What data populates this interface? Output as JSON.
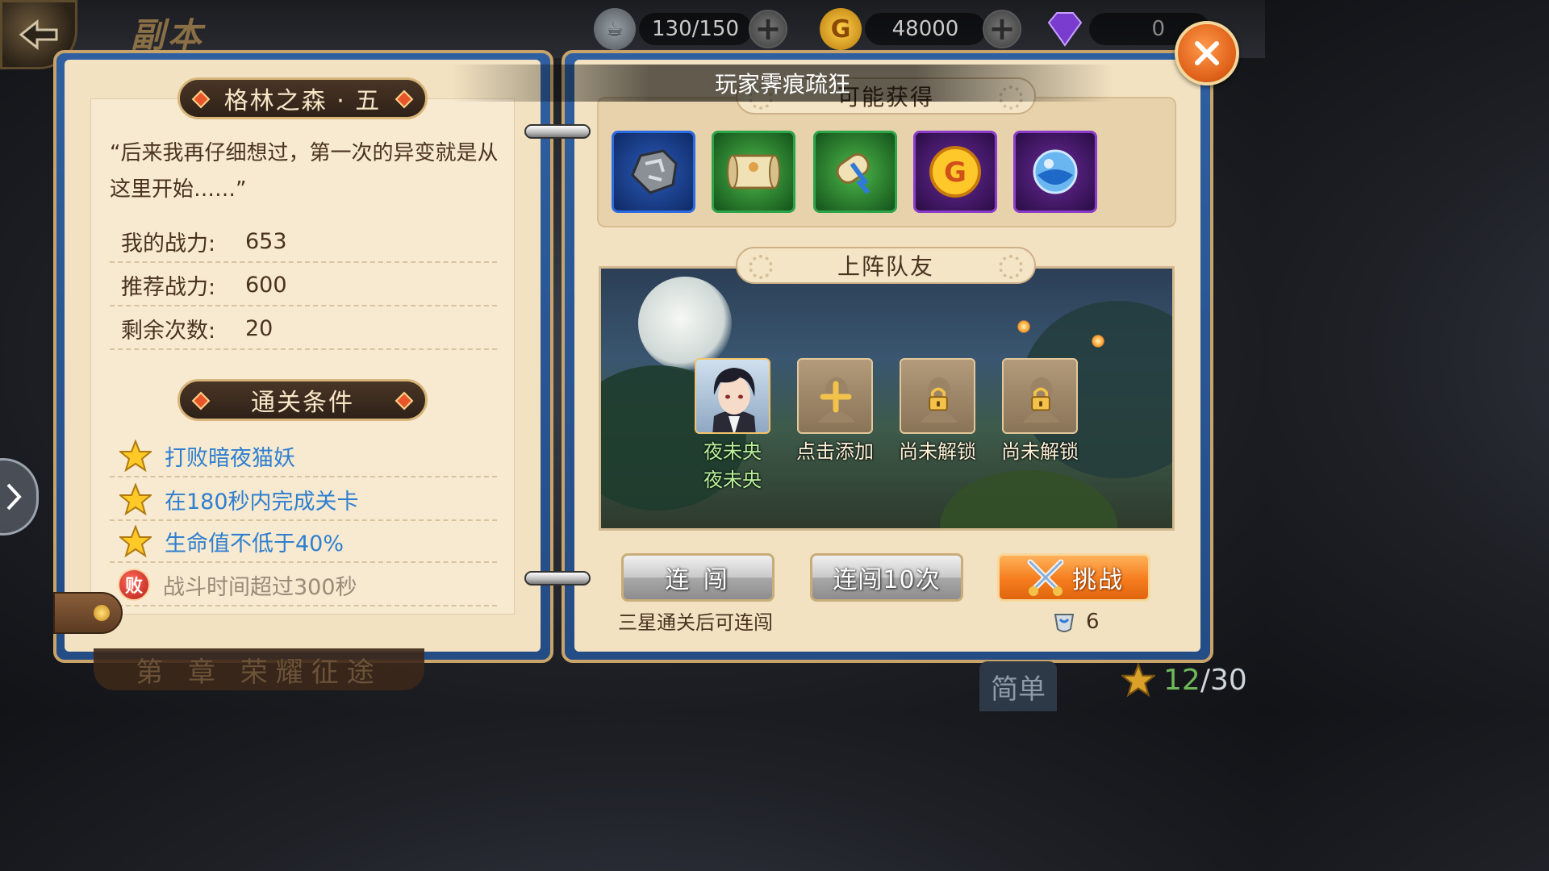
{
  "header": {
    "title": "副本",
    "stamina": "130/150",
    "gold": "48000",
    "gems": "0"
  },
  "notice": "玩家霁痕疏狂",
  "stage": {
    "name": "格林之森 · 五",
    "quote": "“后来我再仔细想过，第一次的异变就是从这里开始……”",
    "stats": [
      {
        "label": "我的战力:",
        "value": "653"
      },
      {
        "label": "推荐战力:",
        "value": "600"
      },
      {
        "label": "剩余次数:",
        "value": "20"
      }
    ]
  },
  "conditions": {
    "title": "通关条件",
    "items": [
      {
        "text": "打败暗夜猫妖",
        "type": "star"
      },
      {
        "text": "在180秒内完成关卡",
        "type": "star"
      },
      {
        "text": "生命值不低于40%",
        "type": "star"
      },
      {
        "text": "战斗时间超过300秒",
        "type": "fail",
        "badge": "败"
      }
    ]
  },
  "rewards": {
    "title": "可能获得",
    "items": [
      {
        "icon": "ore-stone-icon",
        "border": "#2d6be0"
      },
      {
        "icon": "scroll-icon",
        "border": "#2ea44a"
      },
      {
        "icon": "blue-ribbon-scroll-icon",
        "border": "#2ea44a"
      },
      {
        "icon": "gold-coin-icon",
        "border": "#8b3cc9"
      },
      {
        "icon": "crystal-orb-icon",
        "border": "#8b3cc9"
      }
    ]
  },
  "team": {
    "title": "上阵队友",
    "slots": [
      {
        "label": "夜未央",
        "state": "hero"
      },
      {
        "label": "点击添加",
        "state": "add"
      },
      {
        "label": "尚未解锁",
        "state": "locked"
      },
      {
        "label": "尚未解锁",
        "state": "locked"
      }
    ],
    "hero_name_repeat": "夜未央"
  },
  "actions": {
    "consecutive": "连 闯",
    "consecutive_10": "连闯10次",
    "challenge": "挑战",
    "consecutive_note": "三星通关后可连闯",
    "cost": "6"
  },
  "footer": {
    "chapter": "第 章 荣耀征途",
    "difficulty": "简单",
    "stars_current": "12",
    "stars_total": "/30"
  },
  "colors": {
    "accent_orange": "#f57d1e",
    "condition_blue": "#2f7fd0",
    "star_total_green": "#6fb85a"
  }
}
